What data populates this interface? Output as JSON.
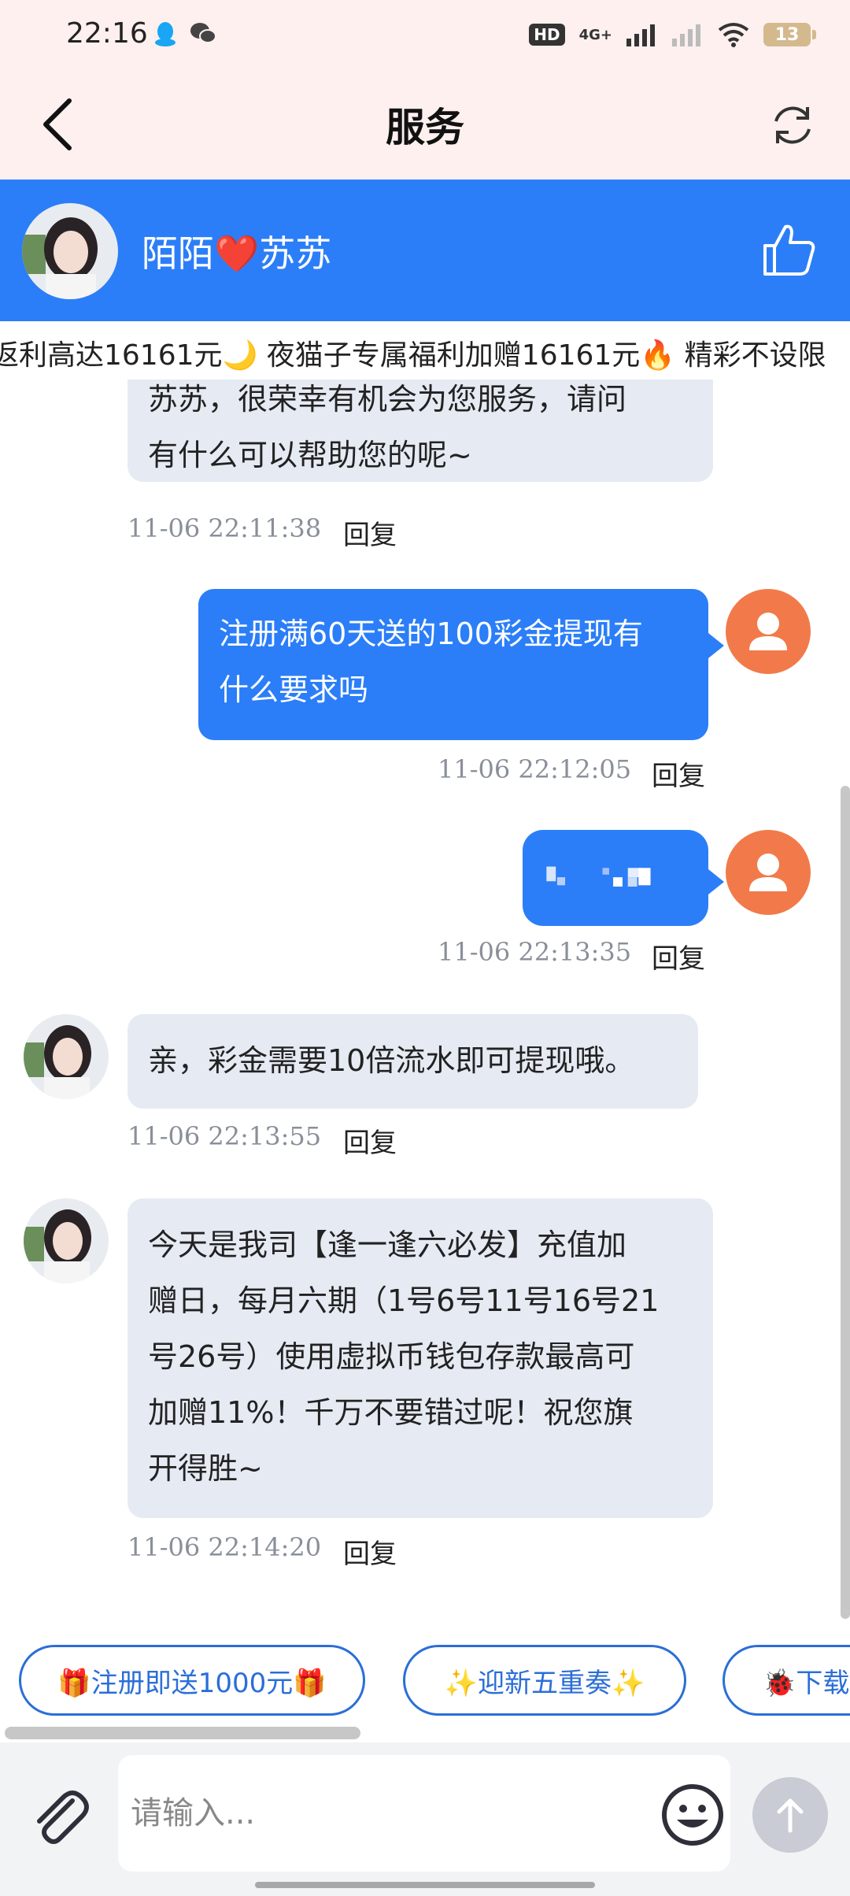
{
  "status_bar": {
    "time": "22:16",
    "hd": "HD",
    "network": "4G+",
    "battery": "13"
  },
  "header": {
    "title": "服务"
  },
  "agent": {
    "name": "陌陌❤️苏苏"
  },
  "marquee": {
    "text": "返利高达16161元🌙 夜猫子专属福利加赠16161元🔥 精彩不设限"
  },
  "messages": [
    {
      "side": "in",
      "lines": [
        "苏苏，很荣幸有机会为您服务，请问",
        "有什么可以帮助您的呢~"
      ],
      "time": "11-06 22:11:38",
      "reply": "回复"
    },
    {
      "side": "out",
      "lines": [
        "注册满60天送的100彩金提现有",
        "什么要求吗"
      ],
      "time": "11-06 22:12:05",
      "reply": "回复"
    },
    {
      "side": "out",
      "lines": [
        ""
      ],
      "time": "11-06 22:13:35",
      "reply": "回复"
    },
    {
      "side": "in",
      "lines": [
        "亲，彩金需要10倍流水即可提现哦。"
      ],
      "time": "11-06 22:13:55",
      "reply": "回复"
    },
    {
      "side": "in",
      "lines": [
        "今天是我司【逢一逢六必发】充值加",
        "赠日，每月六期（1号6号11号16号21",
        "号26号）使用虚拟币钱包存款最高可",
        "加赠11%！千万不要错过呢！祝您旗",
        "开得胜~"
      ],
      "time": "11-06 22:14:20",
      "reply": "回复"
    }
  ],
  "quick_chips": [
    "🎁注册即送1000元🎁",
    "✨迎新五重奏✨",
    "🐞下载"
  ],
  "input": {
    "placeholder": "请输入..."
  },
  "icons": {
    "back": "back-arrow-icon",
    "refresh": "refresh-icon",
    "like": "thumbs-up-icon",
    "attach": "paperclip-icon",
    "emoji": "emoji-icon",
    "send": "send-arrow-icon"
  },
  "colors": {
    "accent": "#2b7ef8",
    "header_bg": "#fdf0ee",
    "user_avatar": "#f27a4a",
    "incoming_bubble": "#e5eaf3"
  }
}
